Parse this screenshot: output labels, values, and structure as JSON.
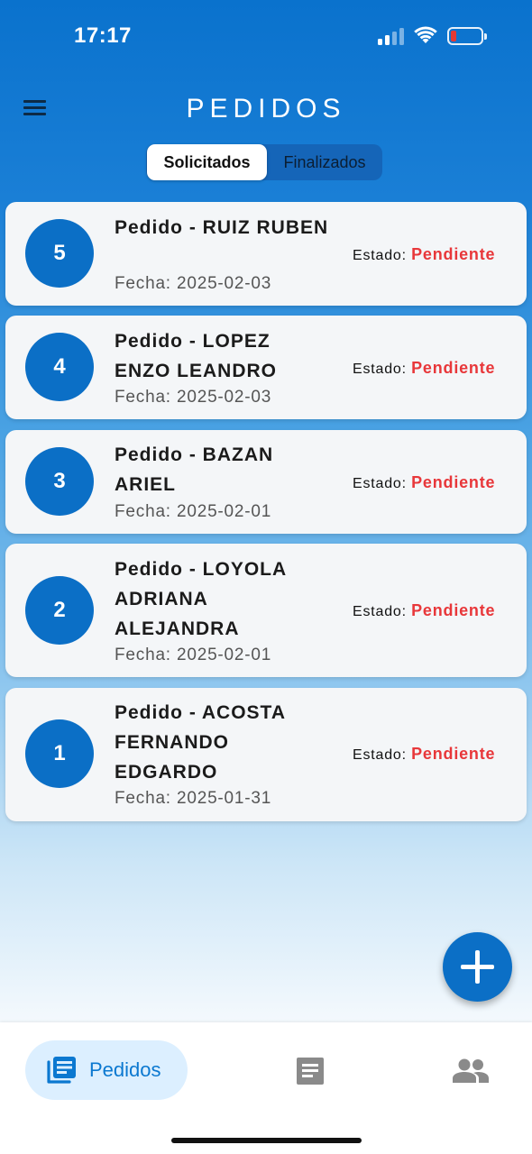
{
  "status_bar": {
    "time": "17:17"
  },
  "header": {
    "title": "PEDIDOS"
  },
  "tabs": [
    {
      "label": "Solicitados",
      "active": true
    },
    {
      "label": "Finalizados",
      "active": false
    }
  ],
  "orders": [
    {
      "number": "5",
      "title": "Pedido - RUIZ RUBEN",
      "date": "Fecha: 2025-02-03",
      "status_label": "Estado:",
      "status_value": "Pendiente"
    },
    {
      "number": "4",
      "title": "Pedido - LOPEZ ENZO LEANDRO",
      "date": "Fecha: 2025-02-03",
      "status_label": "Estado:",
      "status_value": "Pendiente"
    },
    {
      "number": "3",
      "title": "Pedido - BAZAN ARIEL",
      "date": "Fecha: 2025-02-01",
      "status_label": "Estado:",
      "status_value": "Pendiente"
    },
    {
      "number": "2",
      "title": "Pedido - LOYOLA ADRIANA ALEJANDRA",
      "date": "Fecha: 2025-02-01",
      "status_label": "Estado:",
      "status_value": "Pendiente"
    },
    {
      "number": "1",
      "title": "Pedido - ACOSTA FERNANDO EDGARDO",
      "date": "Fecha: 2025-01-31",
      "status_label": "Estado:",
      "status_value": "Pendiente"
    }
  ],
  "fab": {
    "icon": "plus-icon"
  },
  "bottom_nav": {
    "items": [
      {
        "label": "Pedidos",
        "icon": "orders-list-icon",
        "active": true
      },
      {
        "label": "",
        "icon": "document-icon",
        "active": false
      },
      {
        "label": "",
        "icon": "people-icon",
        "active": false
      }
    ]
  },
  "colors": {
    "primary": "#0b6fc6",
    "status_pending": "#e8373a",
    "nav_active_bg": "#dcefff",
    "nav_active_fg": "#0b78d0",
    "nav_inactive": "#8a8a8a"
  }
}
